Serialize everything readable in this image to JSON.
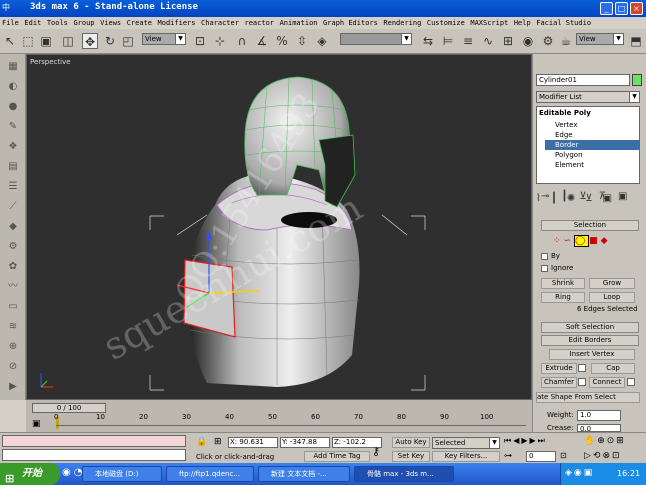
{
  "window": {
    "title": "3ds max 6 - Stand-alone License",
    "lang_indicator": "中"
  },
  "menu": [
    "File",
    "Edit",
    "Tools",
    "Group",
    "Views",
    "Create",
    "Modifiers",
    "Character",
    "reactor",
    "Animation",
    "Graph Editors",
    "Rendering",
    "Customize",
    "MAXScript",
    "Help",
    "Facial Studio"
  ],
  "toolbar": {
    "view_dropdown": "View",
    "view_dropdown2": "View"
  },
  "viewport": {
    "label": "Perspective",
    "watermark1": "squeenhui.com",
    "watermark2": "QQ:15416493"
  },
  "panel": {
    "object_name": "Cylinder01",
    "modifier_list_label": "Modifier List",
    "stack": [
      "Editable Poly",
      "Vertex",
      "Edge",
      "Border",
      "Polygon",
      "Element"
    ],
    "selected_stack_item": "Border",
    "selection_rollout": "Selection",
    "by_label": "By",
    "ignore_label": "Ignore",
    "shrink": "Shrink",
    "grow": "Grow",
    "ring": "Ring",
    "loop": "Loop",
    "selected_info": "6 Edges Selected",
    "soft_selection": "Soft Selection",
    "edit_borders": "Edit Borders",
    "insert_vertex": "Insert Vertex",
    "extrude": "Extrude",
    "cap": "Cap",
    "chamfer": "Chamfer",
    "connect": "Connect",
    "create_shape": "ate Shape From Select",
    "weight_label": "Weight:",
    "weight_value": "1.0",
    "crease_label": "Crease:",
    "crease_value": "0.0"
  },
  "timeline": {
    "frame": "0 / 100",
    "ticks": [
      "0",
      "10",
      "20",
      "30",
      "40",
      "50",
      "60",
      "70",
      "80",
      "90",
      "100"
    ]
  },
  "status": {
    "x_value": "X: 90.631",
    "y_value": "Y: -347.88",
    "z_value": "Z: -102.2",
    "prompt": "Click or click-and-drag",
    "add_time_tag": "Add Time Tag",
    "auto_key": "Auto Key",
    "selected_dropdown": "Selected",
    "set_key": "Set Key",
    "key_filters": "Key Filters...",
    "frame_value": "0"
  },
  "taskbar": {
    "start": "开始",
    "tasks": [
      "本地磁盘 (D:)",
      "ftp://ftp1.qdenc...",
      "新建 文本文档 -...",
      "骨骼 max - 3ds m..."
    ],
    "clock": "16:21"
  },
  "colors": {
    "titlebar": "#0a5fd8",
    "viewport_bg": "#2f2f2f",
    "selection_highlight": "#3a6ea5",
    "taskbar": "#2356c8",
    "start": "#3a9a2a"
  }
}
